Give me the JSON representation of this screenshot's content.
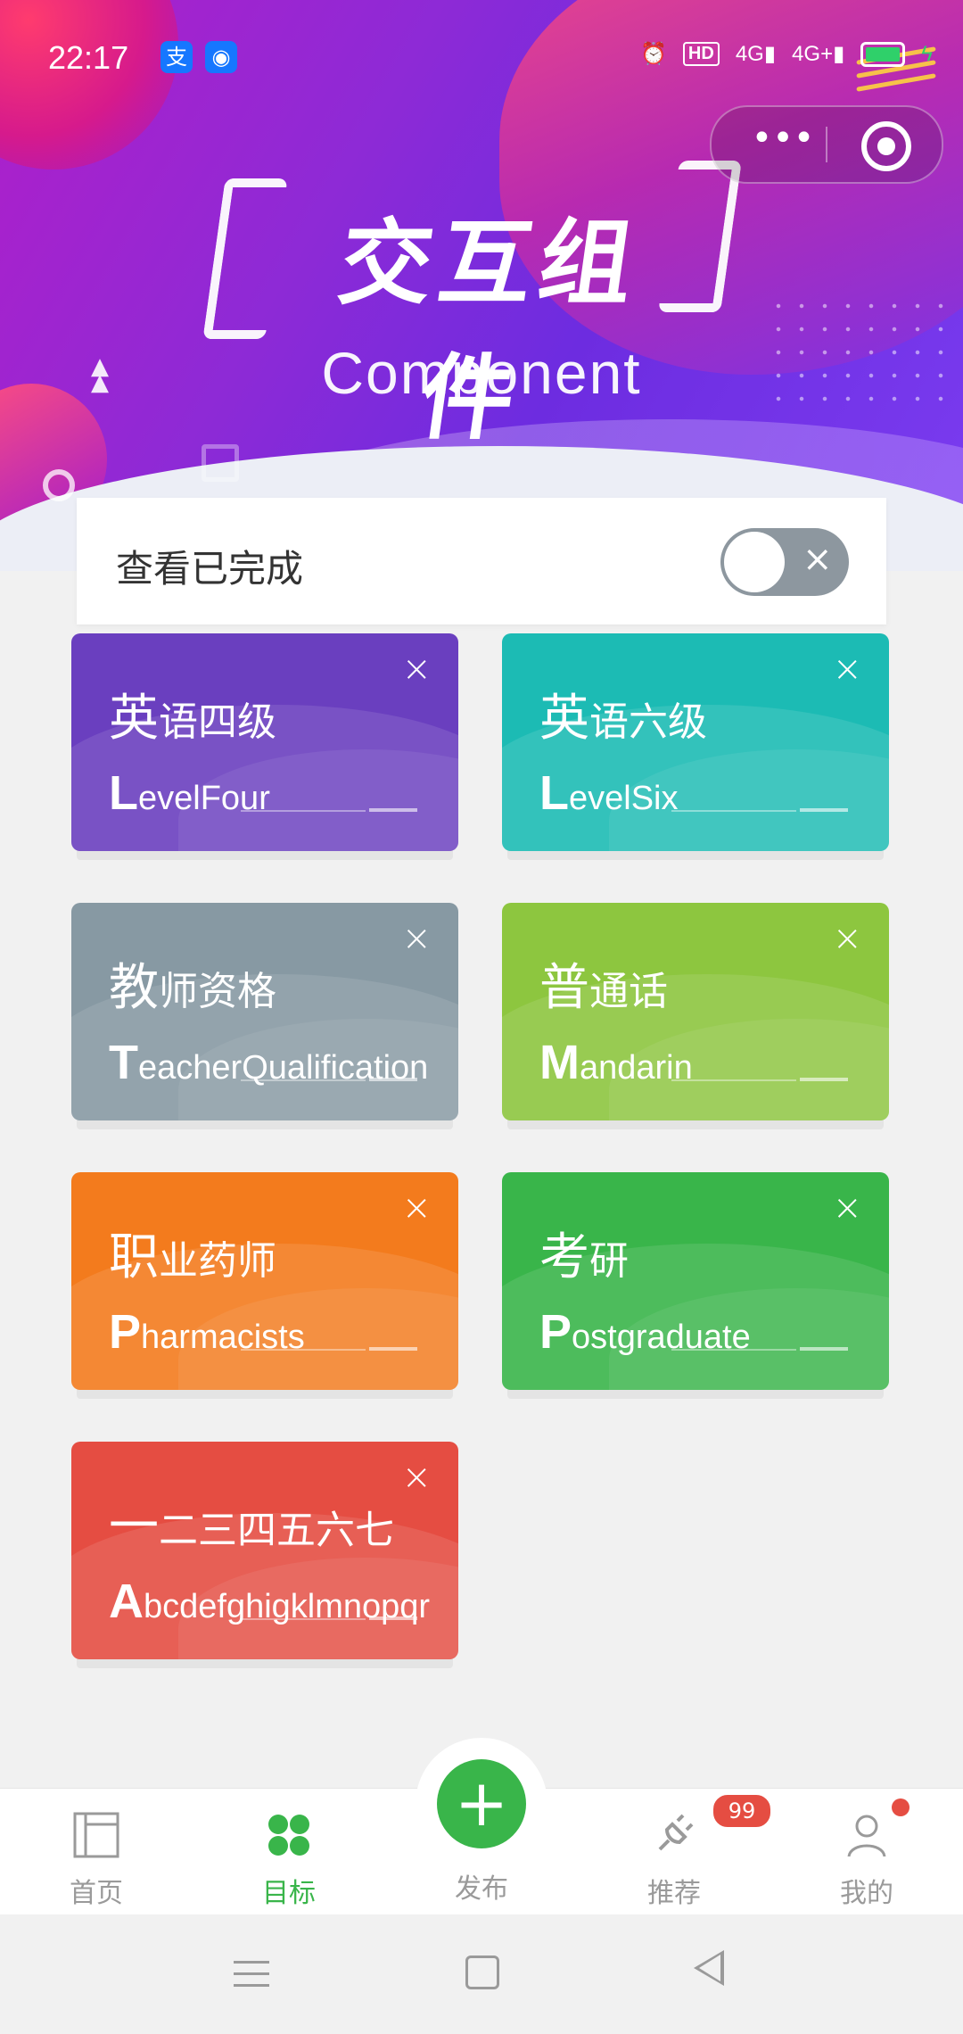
{
  "status_bar": {
    "time": "22:17",
    "icons": [
      "alipay-icon",
      "android-icon",
      "alarm-icon",
      "hd-icon",
      "signal-4g-icon",
      "signal-4g-plus-icon",
      "battery-icon",
      "charging-icon"
    ],
    "hd_label": "HD",
    "net1": "4G",
    "net2": "4G+"
  },
  "hero": {
    "title": "交互组件",
    "subtitle": "Component"
  },
  "toggle": {
    "label": "查看已完成",
    "state": "off",
    "off_icon": "×"
  },
  "cards": [
    {
      "cn_first": "英",
      "cn_rest": "语四级",
      "en_first": "L",
      "en_rest": "evelFour",
      "color": "#6a3fbf",
      "close": "×"
    },
    {
      "cn_first": "英",
      "cn_rest": "语六级",
      "en_first": "L",
      "en_rest": "evelSix",
      "color": "#1cbbb4",
      "close": "×"
    },
    {
      "cn_first": "教",
      "cn_rest": "师资格",
      "en_first": "T",
      "en_rest": "eacherQualification",
      "color": "#8799a3",
      "close": "×"
    },
    {
      "cn_first": "普",
      "cn_rest": "通话",
      "en_first": "M",
      "en_rest": "andarin",
      "color": "#8dc63f",
      "close": "×"
    },
    {
      "cn_first": "职",
      "cn_rest": "业药师",
      "en_first": "P",
      "en_rest": "harmacists",
      "color": "#f37b1d",
      "close": "×"
    },
    {
      "cn_first": "考",
      "cn_rest": "研",
      "en_first": "P",
      "en_rest": "ostgraduate",
      "color": "#39b54a",
      "close": "×"
    },
    {
      "cn_first": "一",
      "cn_rest": "二三四五六七",
      "en_first": "A",
      "en_rest": "bcdefghigklmnopqr",
      "color": "#e54d42",
      "close": "×"
    }
  ],
  "tabbar": {
    "tabs": [
      {
        "label": "首页",
        "icon": "home-page-icon"
      },
      {
        "label": "目标",
        "icon": "target-grid-icon",
        "active": true
      },
      {
        "label": "发布",
        "icon": "plus-icon"
      },
      {
        "label": "推荐",
        "icon": "plug-icon",
        "badge": "99"
      },
      {
        "label": "我的",
        "icon": "user-icon"
      }
    ],
    "fab_symbol": "+",
    "accent": "#39b54a",
    "badge_color": "#e54d42"
  },
  "capsule": {
    "more_symbol": "•••"
  }
}
